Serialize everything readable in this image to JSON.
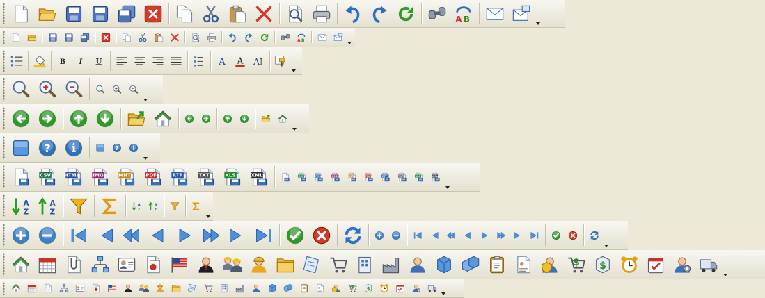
{
  "rows": [
    {
      "id": "standard-large",
      "size": "L",
      "items": [
        "new-document-icon",
        "open-folder-icon",
        "save-icon",
        "save-as-icon",
        "save-all-icon",
        "close-icon",
        "|",
        "copy-icon",
        "cut-icon",
        "paste-icon",
        "delete-icon",
        "|",
        "print-preview-icon",
        "print-icon",
        "|",
        "undo-icon",
        "redo-icon",
        "refresh-icon",
        "|",
        "find-icon",
        "spell-check-icon",
        "|",
        "email-icon",
        "send-icon"
      ],
      "overflow": true
    },
    {
      "id": "standard-small",
      "size": "S",
      "items": [
        "new-document-icon",
        "open-folder-icon",
        "|",
        "save-icon",
        "save-as-icon",
        "save-all-icon",
        "|",
        "close-icon",
        "|",
        "copy-icon",
        "cut-icon",
        "paste-icon",
        "delete-icon",
        "|",
        "print-preview-icon",
        "print-icon",
        "|",
        "undo-icon",
        "redo-icon",
        "refresh-icon",
        "|",
        "find-icon",
        "spell-check-icon",
        "|",
        "email-icon",
        "send-icon"
      ],
      "overflow": true
    },
    {
      "id": "formatting",
      "size": "M",
      "items": [
        "bullet-list-icon",
        "|",
        "fill-color-icon",
        "|",
        "bold-icon",
        "italic-icon",
        "underline-icon",
        "|",
        "align-left-icon",
        "align-center-icon",
        "align-right-icon",
        "justify-icon",
        "|",
        "list-icon",
        "|",
        "font-icon",
        "font-color-icon",
        "font-size-icon",
        "|",
        "format-painter-icon"
      ],
      "overflow": true
    },
    {
      "id": "zoom",
      "size": "L",
      "items": [
        "zoom-icon",
        "zoom-in-icon",
        "zoom-out-icon",
        "|",
        "zoom-icon-small",
        "zoom-in-icon-small",
        "zoom-out-icon-small"
      ],
      "overflow": true
    },
    {
      "id": "navigation",
      "size": "L",
      "items": [
        "back-icon",
        "forward-icon",
        "|",
        "up-icon",
        "down-icon",
        "|",
        "open-up-icon",
        "home-icon",
        "|",
        "back-icon-small",
        "forward-icon-small",
        "|",
        "up-icon-small",
        "down-icon-small",
        "|",
        "open-up-icon-small",
        "home-icon-small"
      ],
      "overflow": true
    },
    {
      "id": "help",
      "size": "L",
      "items": [
        "square-icon",
        "help-icon",
        "info-icon",
        "|",
        "square-icon-small",
        "help-icon-small",
        "info-icon-small"
      ],
      "overflow": true
    },
    {
      "id": "export",
      "size": "L",
      "items": [
        "export-icon",
        "export-csv-icon",
        "export-html-icon",
        "export-img-icon",
        "export-mht-icon",
        "export-pdf-icon",
        "export-rtf-icon",
        "export-txt-icon",
        "export-xls-icon",
        "export-xml-icon",
        "|",
        "export-icon-small",
        "export-csv-icon-small",
        "export-html-icon-small",
        "export-img-icon-small",
        "export-mht-icon-small",
        "export-pdf-icon-small",
        "export-rtf-icon-small",
        "export-txt-icon-small",
        "export-xls-icon-small",
        "export-xml-icon-small"
      ],
      "overflow": true
    },
    {
      "id": "data",
      "size": "L",
      "items": [
        "sort-asc-icon",
        "sort-desc-icon",
        "|",
        "filter-icon",
        "|",
        "sum-icon",
        "|",
        "sort-asc-icon-small",
        "sort-desc-icon-small",
        "|",
        "filter-icon-small",
        "|",
        "sum-icon-small"
      ],
      "overflow": true
    },
    {
      "id": "record-navigation",
      "size": "L",
      "items": [
        "add-icon",
        "remove-icon",
        "|",
        "first-icon",
        "prev-page-icon",
        "rewind-icon",
        "prev-icon",
        "next-icon",
        "fast-forward-icon",
        "next-page-icon",
        "last-icon",
        "|",
        "ok-icon",
        "cancel-icon",
        "|",
        "sync-icon",
        "|",
        "add-icon-small",
        "remove-icon-small",
        "|",
        "first-icon-small",
        "prev-page-icon-small",
        "rewind-icon-small",
        "prev-icon-small",
        "next-icon-small",
        "fast-forward-icon-small",
        "next-page-icon-small",
        "last-icon-small",
        "|",
        "ok-icon-small",
        "cancel-icon-small",
        "|",
        "sync-icon-small"
      ],
      "overflow": true
    },
    {
      "id": "business-large",
      "size": "L",
      "items": [
        "home-icon",
        "calendar-icon",
        "attachment-icon",
        "org-chart-icon",
        "contact-card-icon",
        "certificate-icon",
        "flag-icon",
        "user-icon",
        "workers-icon",
        "worker-icon",
        "folder-icon",
        "notes-icon",
        "cart-icon",
        "building-icon",
        "factory-icon",
        "person-icon",
        "box-icon",
        "boxes-icon",
        "clipboard-icon",
        "report-icon",
        "admin-icon",
        "cart-money-icon",
        "money-icon",
        "alarm-icon",
        "tasks-icon",
        "user-settings-icon",
        "truck-icon"
      ],
      "overflow": true
    },
    {
      "id": "business-small",
      "size": "S",
      "items": [
        "home-icon",
        "calendar-icon",
        "attachment-icon",
        "org-chart-icon",
        "contact-card-icon",
        "certificate-icon",
        "flag-icon",
        "user-icon",
        "workers-icon",
        "worker-icon",
        "folder-icon",
        "notes-icon",
        "cart-icon",
        "building-icon",
        "factory-icon",
        "person-icon",
        "box-icon",
        "boxes-icon",
        "clipboard-icon",
        "report-icon",
        "admin-icon",
        "cart-money-icon",
        "money-icon",
        "alarm-icon",
        "tasks-icon",
        "user-settings-icon",
        "truck-icon"
      ],
      "overflow": true
    }
  ],
  "labels": {
    "csv": "CSV",
    "html": "HTML",
    "img": "IMG",
    "mht": "MHT",
    "pdf": "PDF",
    "rtf": "RTF",
    "txt": "TXT",
    "xls": "XLS",
    "xml": "XML",
    "bold": "B",
    "italic": "I",
    "underline": "U",
    "font": "A",
    "az": "AZ"
  }
}
